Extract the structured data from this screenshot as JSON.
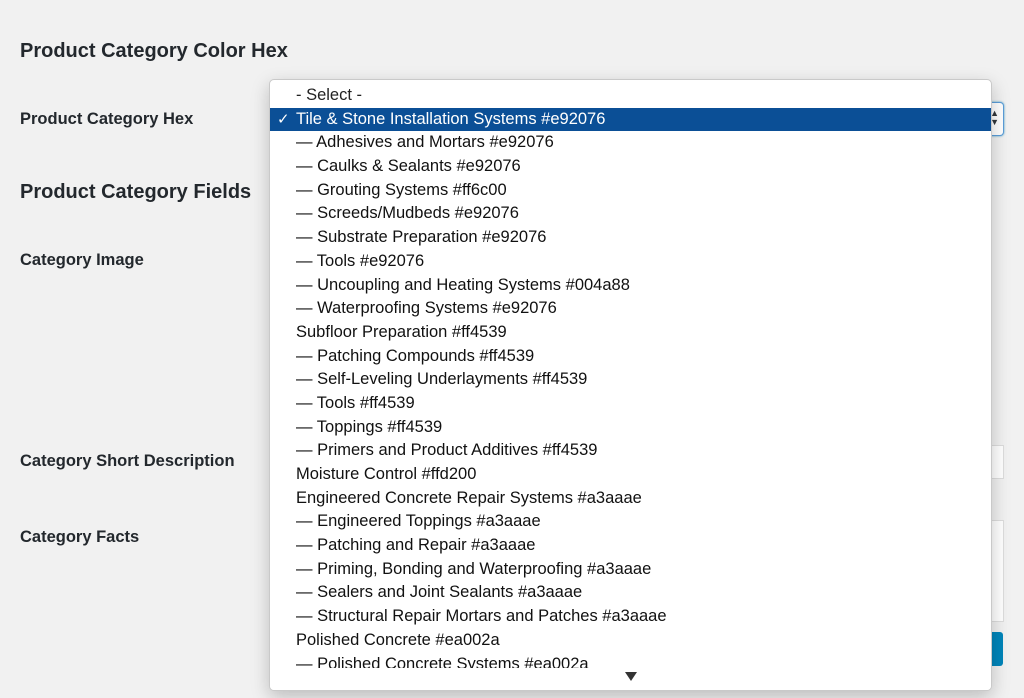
{
  "page": {
    "section_color_title": "Product Category Color Hex",
    "hex_label": "Product Category Hex",
    "section_fields_title": "Product Category Fields",
    "image_label": "Category Image",
    "short_desc_label": "Category Short Description",
    "facts_label": "Category Facts"
  },
  "dropdown": {
    "placeholder": "- Select -",
    "selected_index": 1,
    "check_glyph": "✓",
    "options": [
      "- Select -",
      "Tile & Stone Installation Systems #e92076",
      "— Adhesives and Mortars #e92076",
      "— Caulks & Sealants #e92076",
      "— Grouting Systems #ff6c00",
      "— Screeds/Mudbeds #e92076",
      "— Substrate Preparation #e92076",
      "— Tools #e92076",
      "— Uncoupling and Heating Systems #004a88",
      "— Waterproofing Systems #e92076",
      "Subfloor Preparation #ff4539",
      "— Patching Compounds #ff4539",
      "— Self-Leveling Underlayments #ff4539",
      "— Tools #ff4539",
      "— Toppings #ff4539",
      "— Primers and Product Additives #ff4539",
      "Moisture Control #ffd200",
      "Engineered Concrete Repair Systems #a3aaae",
      "— Engineered Toppings #a3aaae",
      "— Patching and Repair #a3aaae",
      "— Priming, Bonding and Waterproofing #a3aaae",
      "— Sealers and Joint Sealants #a3aaae",
      "— Structural Repair Mortars and Patches #a3aaae",
      "Polished Concrete #ea002a",
      "— Polished Concrete Systems #ea002a"
    ]
  },
  "colors": {
    "background": "#f1f1f1",
    "selected_highlight": "#0b4f96",
    "focus_border": "#5b9dd9",
    "button_primary": "#0085ba"
  }
}
